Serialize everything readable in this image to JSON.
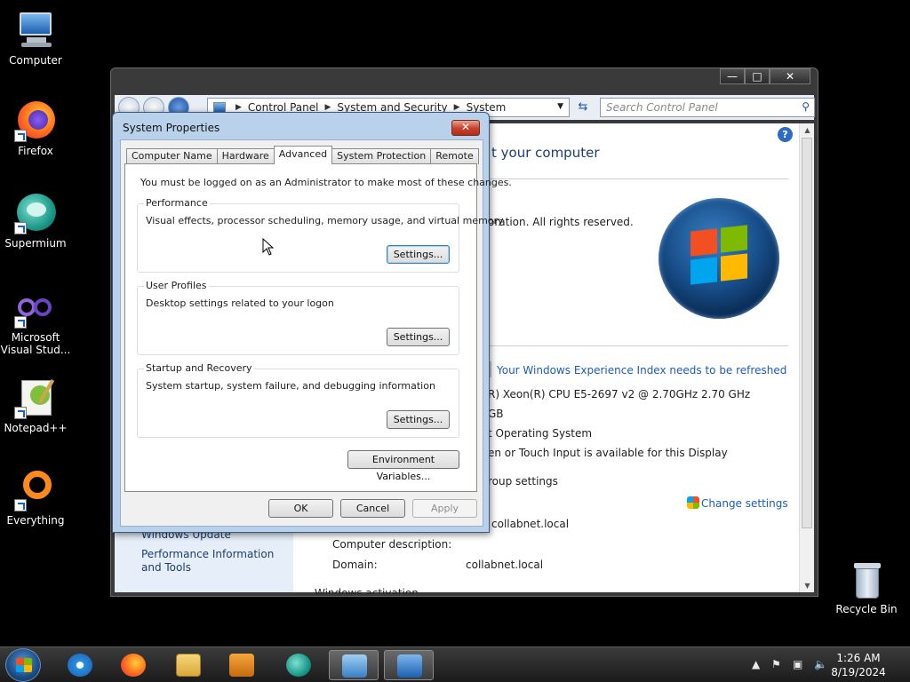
{
  "desktop": {
    "icons": [
      {
        "label": "Computer"
      },
      {
        "label": "Firefox"
      },
      {
        "label": "Supermium"
      },
      {
        "label": "Microsoft Visual Stud..."
      },
      {
        "label": "Notepad++"
      },
      {
        "label": "Everything"
      },
      {
        "label": "Recycle Bin"
      }
    ]
  },
  "control_panel": {
    "breadcrumb": [
      "Control Panel",
      "System and Security",
      "System"
    ],
    "search_placeholder": "Search Control Panel",
    "heading_partial": "t your computer",
    "copyright_partial": "oration.  All rights reserved.",
    "experience_link": "Your Windows Experience Index needs to be refreshed",
    "processor_partial": "R) Xeon(R) CPU E5-2697 v2 @ 2.70GHz   2.70 GHz",
    "memory_partial": "GB",
    "system_type_partial": "t Operating System",
    "pen_touch_partial": "en or Touch Input is available for this Display",
    "group_settings_partial": "roup settings",
    "change_settings": "Change settings",
    "full_computer_name_partial": "collabnet.local",
    "computer_description_label": "Computer description:",
    "domain_label": "Domain:",
    "domain_value": "collabnet.local",
    "activation_partial": "Windows activation",
    "left_links": [
      "Windows Update",
      "Performance Information and Tools"
    ]
  },
  "dialog": {
    "title": "System Properties",
    "tabs": [
      "Computer Name",
      "Hardware",
      "Advanced",
      "System Protection",
      "Remote"
    ],
    "active_tab": "Advanced",
    "note": "You must be logged on as an Administrator to make most of these changes.",
    "groups": [
      {
        "label": "Performance",
        "desc": "Visual effects, processor scheduling, memory usage, and virtual memory",
        "button": "Settings..."
      },
      {
        "label": "User Profiles",
        "desc": "Desktop settings related to your logon",
        "button": "Settings..."
      },
      {
        "label": "Startup and Recovery",
        "desc": "System startup, system failure, and debugging information",
        "button": "Settings..."
      }
    ],
    "env_button": "Environment Variables...",
    "ok": "OK",
    "cancel": "Cancel",
    "apply": "Apply"
  },
  "taskbar": {
    "time": "1:26 AM",
    "date": "8/19/2024"
  }
}
